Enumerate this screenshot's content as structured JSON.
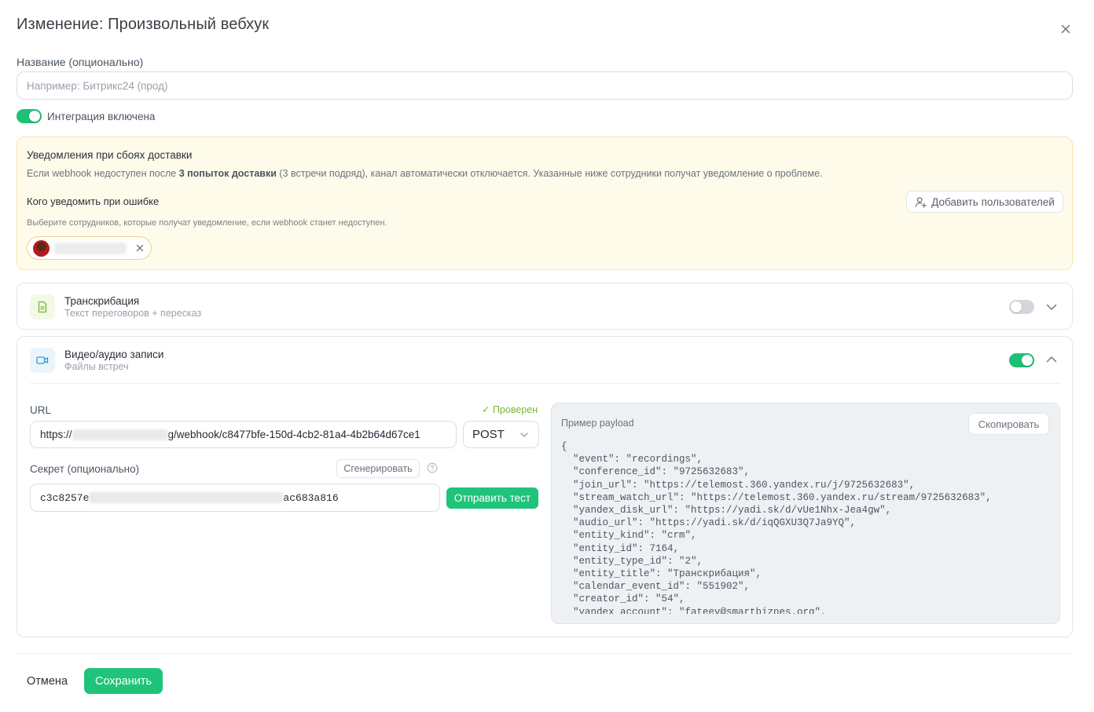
{
  "dialog": {
    "title": "Изменение: Произвольный вебхук"
  },
  "name_field": {
    "label": "Название (опционально)",
    "value": "",
    "placeholder": "Например: Битрикс24 (прод)"
  },
  "integration": {
    "enabled": true,
    "label": "Интеграция включена"
  },
  "notifications": {
    "title": "Уведомления при сбоях доставки",
    "description_before": "Если webhook недоступен после ",
    "description_bold": "3 попыток доставки",
    "description_after": " (3 встречи подряд), канал автоматически отключается. Указанные ниже сотрудники получат уведомление о проблеме.",
    "who_label": "Кого уведомить при ошибке",
    "hint": "Выберите сотрудников, которые получат уведомление, если webhook станет недоступен.",
    "add_users_label": "Добавить пользователей",
    "selected_users": [
      {
        "name_hidden": true,
        "avatar_icon": "user-avatar"
      }
    ]
  },
  "sections": {
    "transcription": {
      "title": "Транскрибация",
      "subtitle": "Текст переговоров + пересказ",
      "enabled": false,
      "expanded": false,
      "icon": "document-icon"
    },
    "recordings": {
      "title": "Видео/аудио записи",
      "subtitle": "Файлы встреч",
      "enabled": true,
      "expanded": true,
      "icon": "video-icon"
    }
  },
  "webhook": {
    "url_label": "URL",
    "verified_label": "✓ Проверен",
    "url_prefix": "https://",
    "url_suffix": "g/webhook/c8477bfe-150d-4cb2-81a4-4b2b64d67ce1",
    "method": "POST",
    "secret_label": "Секрет (опционально)",
    "generate_label": "Сгенерировать",
    "secret_prefix": "c3c8257e",
    "secret_suffix": "ac683a816",
    "send_test_label": "Отправить тест"
  },
  "payload": {
    "title": "Пример payload",
    "copy_label": "Скопировать",
    "code": "{\n  \"event\": \"recordings\",\n  \"conference_id\": \"9725632683\",\n  \"join_url\": \"https://telemost.360.yandex.ru/j/9725632683\",\n  \"stream_watch_url\": \"https://telemost.360.yandex.ru/stream/9725632683\",\n  \"yandex_disk_url\": \"https://yadi.sk/d/vUe1Nhx-Jea4gw\",\n  \"audio_url\": \"https://yadi.sk/d/iqQGXU3Q7Ja9YQ\",\n  \"entity_kind\": \"crm\",\n  \"entity_id\": 7164,\n  \"entity_type_id\": \"2\",\n  \"entity_title\": \"Транскрибация\",\n  \"calendar_event_id\": \"551902\",\n  \"creator_id\": \"54\",\n  \"yandex_account\": \"fateev@smartbiznes.org\","
  },
  "footer": {
    "cancel_label": "Отмена",
    "save_label": "Сохранить"
  },
  "colors": {
    "accent": "#1fc47a",
    "verified": "#7ab33a",
    "notice_bg": "#fffbea"
  }
}
